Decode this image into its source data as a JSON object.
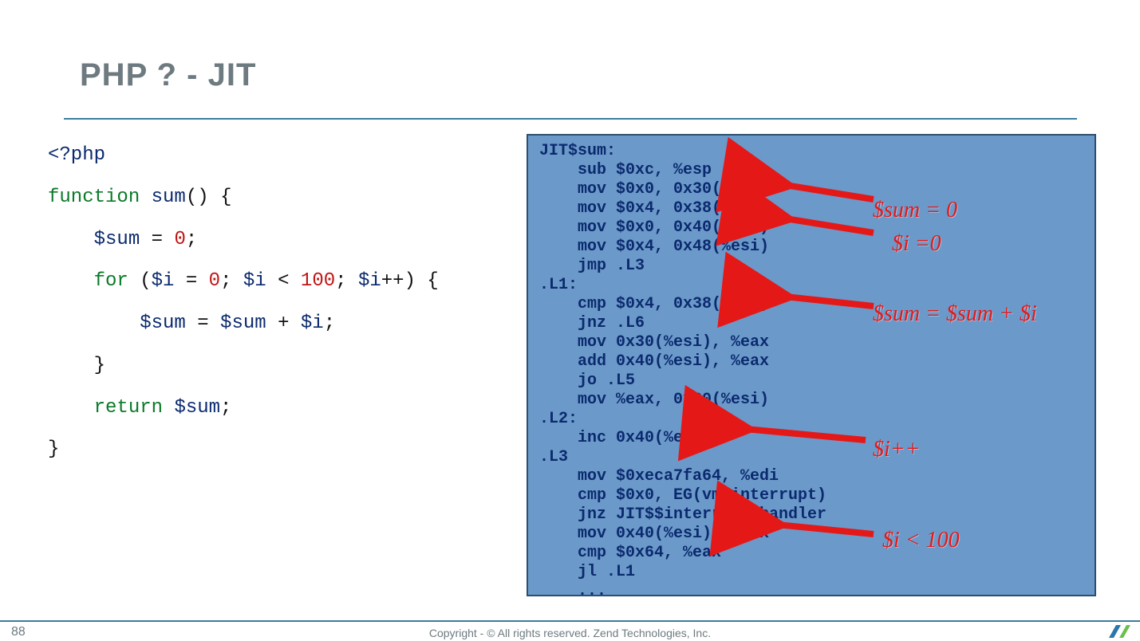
{
  "title": "PHP ? - JIT",
  "php": {
    "l0": "<?php",
    "l1a": "function",
    "l1b": "sum",
    "l1c": "()",
    "l1d": "{",
    "l2a": "$sum",
    "eq": "=",
    "zero": "0",
    "sc": ";",
    "for": "for",
    "lp": "(",
    "i": "$i",
    "lt": "<",
    "hundred": "100",
    "pp": "++",
    "rp": ")",
    "plus": "+",
    "rb": "}",
    "ret": "return"
  },
  "asm": "JIT$sum:\n    sub $0xc, %esp\n    mov $0x0, 0x30(%esi)\n    mov $0x4, 0x38(%esi)\n    mov $0x0, 0x40(%esi)\n    mov $0x4, 0x48(%esi)\n    jmp .L3\n.L1:\n    cmp $0x4, 0x38(%esi)\n    jnz .L6\n    mov 0x30(%esi), %eax\n    add 0x40(%esi), %eax\n    jo .L5\n    mov %eax, 0x30(%esi)\n.L2:\n    inc 0x40(%esi)\n.L3\n    mov $0xeca7fa64, %edi\n    cmp $0x0, EG(vm_interrupt)\n    jnz JIT$$interrupt_handler\n    mov 0x40(%esi), %eax\n    cmp $0x64, %eax\n    jl .L1\n    ...",
  "annotations": {
    "sum0": "$sum = 0",
    "i0": "$i =0",
    "sumadd": "$sum = $sum + $i",
    "iinc": "$i++",
    "ilt": "$i < 100"
  },
  "page": "88",
  "copyright": "Copyright - © All rights reserved. Zend Technologies, Inc."
}
